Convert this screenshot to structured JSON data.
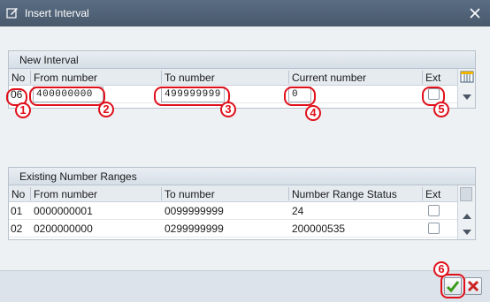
{
  "window": {
    "title": "Insert Interval"
  },
  "new_interval": {
    "caption": "New Interval",
    "headers": {
      "no": "No",
      "from": "From number",
      "to": "To number",
      "current": "Current number",
      "ext": "Ext"
    },
    "row": {
      "no": "06",
      "from": "400000000",
      "to": "499999999",
      "current": "0",
      "ext_checked": false
    }
  },
  "existing_ranges": {
    "caption": "Existing Number Ranges",
    "headers": {
      "no": "No",
      "from": "From number",
      "to": "To number",
      "status": "Number Range Status",
      "ext": "Ext"
    },
    "rows": [
      {
        "no": "01",
        "from": "0000000001",
        "to": "0099999999",
        "status": "24",
        "ext_checked": false
      },
      {
        "no": "02",
        "from": "0200000000",
        "to": "0299999999",
        "status": "200000535",
        "ext_checked": false
      }
    ]
  },
  "annotations": [
    "1",
    "2",
    "3",
    "4",
    "5",
    "6"
  ],
  "colors": {
    "title_bar": "#52657a",
    "annotation_red": "#e0101a",
    "confirm_green": "#3a9a1a",
    "cancel_red": "#cc2222"
  },
  "icons": [
    "dialog-edit-icon",
    "close-icon",
    "table-settings-icon",
    "scroll-up-icon",
    "scroll-down-icon",
    "confirm-check-icon",
    "cancel-x-icon"
  ]
}
